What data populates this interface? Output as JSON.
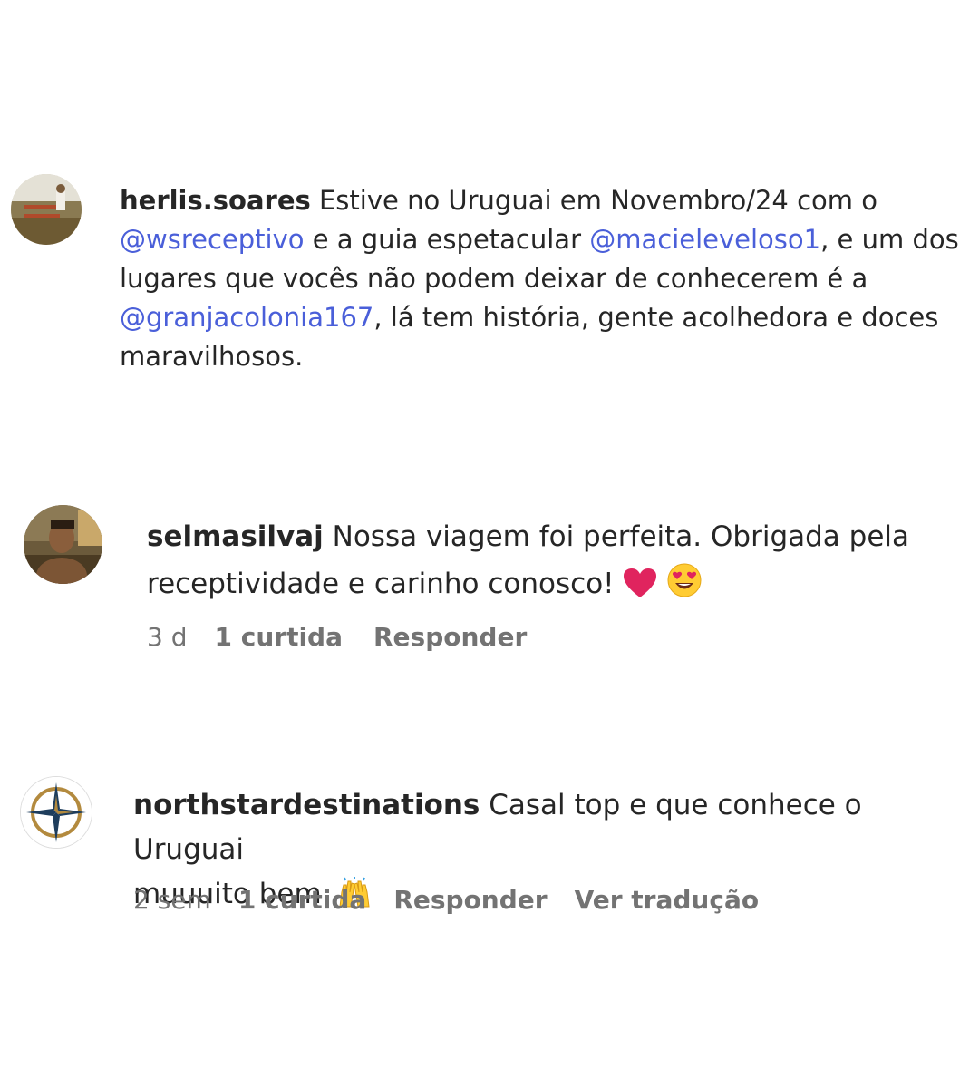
{
  "comments": [
    {
      "username": "herlis.soares",
      "avatar_icon": "farm-photo-avatar",
      "text_parts": [
        "Estive no Uruguai em Novembro/24 com o",
        "@wsreceptivo",
        "e a guia espetacular",
        "@macieleveloso1",
        ", e um dos",
        "lugares que vocês não podem deixar de conhecerem é a",
        "@granjacolonia167",
        ", lá tem história, gente acolhedora e doces",
        "maravilhosos."
      ]
    },
    {
      "username": "selmasilvaj",
      "avatar_icon": "person-photo-avatar",
      "text_line1": "Nossa viagem foi perfeita. Obrigada pela",
      "text_line2": "receptividade e carinho conosco!",
      "emojis": [
        "heart-icon",
        "heart-eyes-emoji-icon"
      ],
      "time": "3 d",
      "likes": "1 curtida",
      "reply": "Responder"
    },
    {
      "username": "northstardestinations",
      "avatar_icon": "compass-rose-avatar",
      "text_line1": "Casal top e que conhece o Uruguai",
      "text_line2": "muuuito bem",
      "emojis": [
        "raising-hands-icon"
      ],
      "time": "2 sem",
      "likes": "1 curtida",
      "reply": "Responder",
      "translate": "Ver tradução"
    }
  ],
  "colors": {
    "text": "#262626",
    "mention": "#4a5fd9",
    "meta": "#737373"
  }
}
